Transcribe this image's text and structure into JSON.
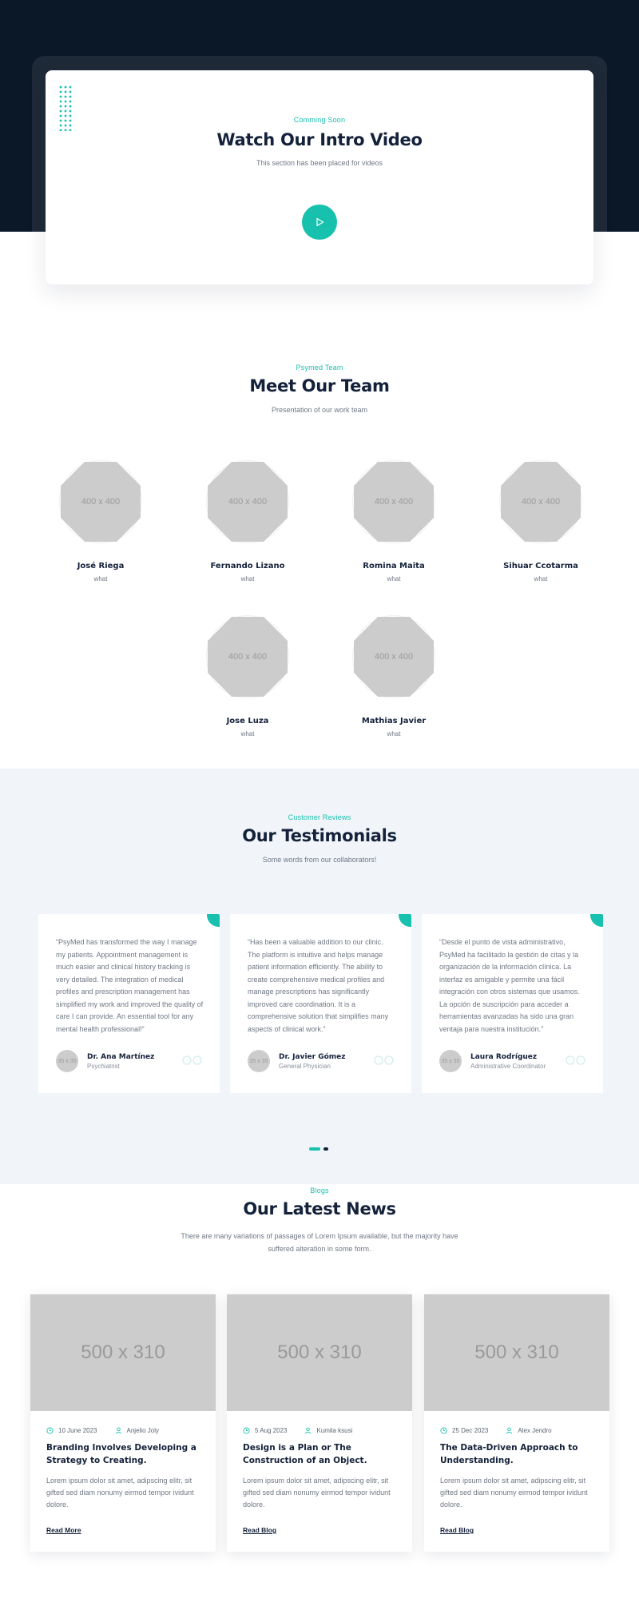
{
  "colors": {
    "accent": "#18c1ad",
    "dark": "#0b1828",
    "text": "#14213a",
    "muted": "#6f7785",
    "placeholder": "#cccccc",
    "section_bg": "#f1f5f9"
  },
  "intro": {
    "eyebrow": "Comming Soon",
    "title": "Watch Our Intro Video",
    "subtitle": "This section has been placed for videos",
    "play_icon": "play-icon"
  },
  "team": {
    "eyebrow": "Psymed Team",
    "title": "Meet Our Team",
    "subtitle": "Presentation of our work team",
    "members": [
      {
        "name": "José Riega",
        "role": "what",
        "photo": "400 x 400"
      },
      {
        "name": "Fernando Lizano",
        "role": "what",
        "photo": "400 x 400"
      },
      {
        "name": "Romina Maita",
        "role": "what",
        "photo": "400 x 400"
      },
      {
        "name": "Sihuar Ccotarma",
        "role": "what",
        "photo": "400 x 400"
      },
      {
        "name": "Jose Luza",
        "role": "what",
        "photo": "400 x 400"
      },
      {
        "name": "Mathias Javier",
        "role": "what",
        "photo": "400 x 400"
      }
    ]
  },
  "testimonials": {
    "eyebrow": "Customer Reviews",
    "title": "Our Testimonials",
    "subtitle": "Some words from our collaborators!",
    "items": [
      {
        "quote": "“PsyMed has transformed the way I manage my patients. Appointment management is much easier and clinical history tracking is very detailed. The integration of medical profiles and prescription management has simplified my work and improved the quality of care I can provide. An essential tool for any mental health professional!”",
        "name": "Dr. Ana Martínez",
        "role": "Psychiatrist",
        "avatar": "35 x 35"
      },
      {
        "quote": "“Has been a valuable addition to our clinic. The platform is intuitive and helps manage patient information efficiently. The ability to create comprehensive medical profiles and manage prescriptions has significantly improved care coordination. It is a comprehensive solution that simplifies many aspects of clinical work.”",
        "name": "Dr. Javier Gómez",
        "role": "General Physician",
        "avatar": "35 x 35"
      },
      {
        "quote": "“Desde el punto de vista administrativo, PsyMed ha facilitado la gestión de citas y la organización de la información clínica. La interfaz es amigable y permite una fácil integración con otros sistemas que usamos. La opción de suscripción para acceder a herramientas avanzadas ha sido una gran ventaja para nuestra institución.”",
        "name": "Laura Rodríguez",
        "role": "Administrative Coordinator",
        "avatar": "35 x 35"
      }
    ],
    "pager": {
      "pages": 2,
      "active": 1
    }
  },
  "blog": {
    "eyebrow": "Blogs",
    "title": "Our Latest News",
    "subtitle_line1": "There are many variations of passages of Lorem Ipsum available, but the majority have",
    "subtitle_line2": "suffered alteration in some form.",
    "posts": [
      {
        "image": "500 x 310",
        "date": "10 June 2023",
        "author": "Anjelio Joly",
        "title": "Branding Involves Developing a Strategy to Creating.",
        "excerpt": "Lorem ipsum dolor sit amet, adipscing elitr, sit gifted sed diam nonumy eirmod tempor ividunt dolore.",
        "link": "Read More"
      },
      {
        "image": "500 x 310",
        "date": "5 Aug 2023",
        "author": "Kumila ksusi",
        "title": "Design is a Plan or The Construction of an Object.",
        "excerpt": "Lorem ipsum dolor sit amet, adipscing elitr, sit gifted sed diam nonumy eirmod tempor ividunt dolore.",
        "link": "Read Blog"
      },
      {
        "image": "500 x 310",
        "date": "25 Dec 2023",
        "author": "Alex Jendro",
        "title": "The Data-Driven Approach to Understanding.",
        "excerpt": "Lorem ipsum dolor sit amet, adipscing elitr, sit gifted sed diam nonumy eirmod tempor ividunt dolore.",
        "link": "Read Blog"
      }
    ]
  }
}
